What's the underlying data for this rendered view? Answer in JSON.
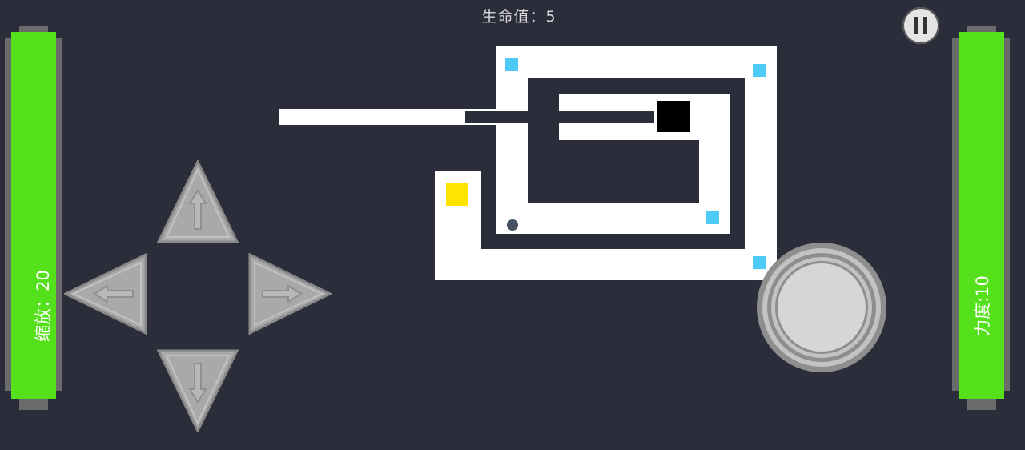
{
  "hud": {
    "lives_label": "生命值：",
    "lives_value": "5",
    "pause_icon": "pause-icon"
  },
  "left_gauge": {
    "label": "缩放：",
    "value": "20",
    "color": "#55e01c"
  },
  "right_gauge": {
    "label": "力度:",
    "value": "10",
    "color": "#55e01c"
  },
  "dpad": {
    "up_icon": "arrow-up-icon",
    "down_icon": "arrow-down-icon",
    "left_icon": "arrow-left-icon",
    "right_icon": "arrow-right-icon"
  },
  "colors": {
    "background": "#2c2d3b",
    "wall": "#ffffff",
    "gem": "#4fc9f5",
    "goal": "#ffe400",
    "player": "#000000",
    "ball": "#474f63"
  }
}
